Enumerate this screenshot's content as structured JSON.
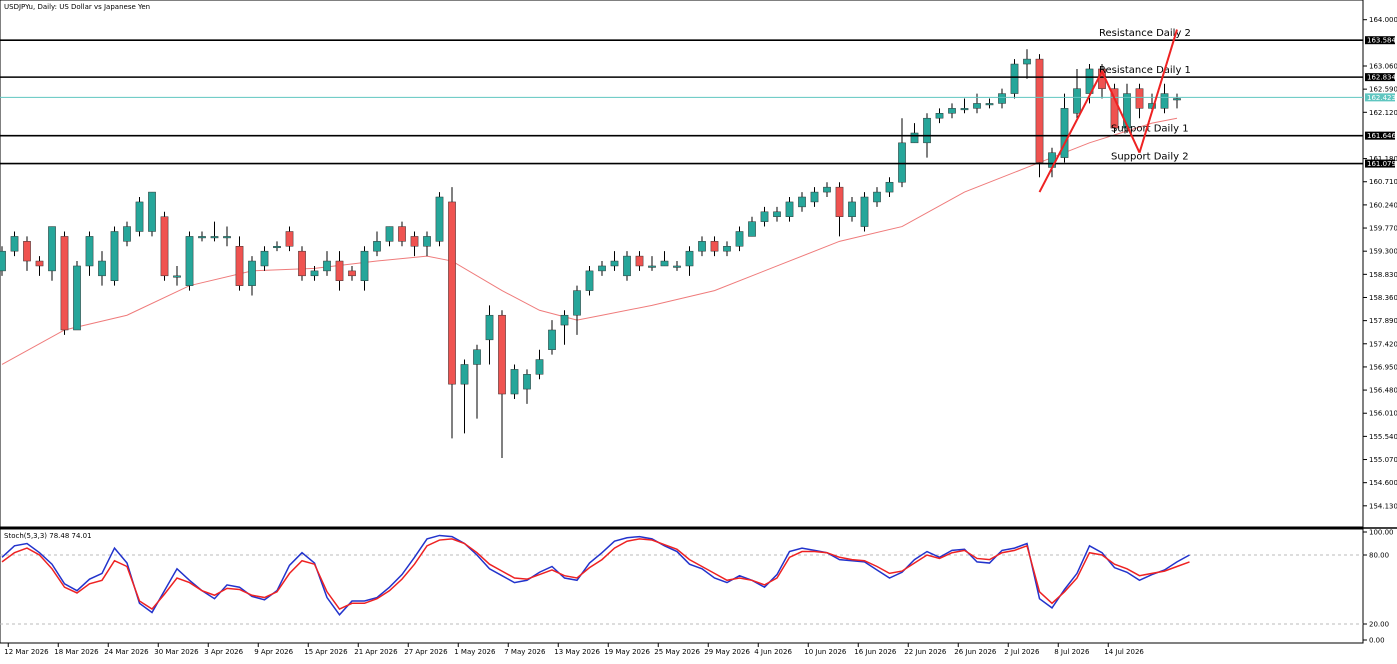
{
  "window": {
    "title": "USDJPYu, Daily:  US Dollar vs Japanese Yen"
  },
  "colors": {
    "bull": "#26a69a",
    "bear": "#ef5350",
    "wick": "#000000",
    "ma": "#ef7b7b",
    "current_price_line": "#5fc6c0",
    "level_line": "#000000",
    "stoch_k": "#2233cc",
    "stoch_d": "#ee2222",
    "trend": "#ee2222"
  },
  "chart_data": [
    {
      "type": "candlestick",
      "title": "USDJPYu, Daily:  US Dollar vs Japanese Yen",
      "ylim": [
        153.7,
        164.4
      ],
      "y_ticks": [
        "164.000",
        "163.060",
        "162.590",
        "162.120",
        "161.180",
        "160.710",
        "160.240",
        "159.770",
        "159.300",
        "158.830",
        "158.360",
        "157.890",
        "157.420",
        "156.950",
        "156.480",
        "156.010",
        "155.540",
        "155.070",
        "154.600",
        "154.130"
      ],
      "x_tick_labels": [
        "12 Mar 2026",
        "18 Mar 2026",
        "24 Mar 2026",
        "30 Mar 2026",
        "3 Apr 2026",
        "9 Apr 2026",
        "15 Apr 2026",
        "21 Apr 2026",
        "27 Apr 2026",
        "1 May 2026",
        "7 May 2026",
        "13 May 2026",
        "19 May 2026",
        "25 May 2026",
        "29 May 2026",
        "4 Jun 2026",
        "10 Jun 2026",
        "16 Jun 2026",
        "22 Jun 2026",
        "26 Jun 2026",
        "2 Jul 2026",
        "8 Jul 2026",
        "14 Jul 2026"
      ],
      "candles": [
        [
          158.9,
          159.3,
          158.8,
          159.4
        ],
        [
          159.3,
          159.6,
          159.2,
          159.7
        ],
        [
          159.5,
          159.1,
          158.9,
          159.6
        ],
        [
          159.1,
          159.0,
          158.8,
          159.2
        ],
        [
          158.9,
          159.8,
          158.7,
          159.8
        ],
        [
          159.6,
          157.7,
          157.6,
          159.7
        ],
        [
          157.7,
          159.0,
          157.7,
          159.1
        ],
        [
          159.0,
          159.6,
          158.8,
          159.7
        ],
        [
          158.8,
          159.1,
          158.6,
          159.3
        ],
        [
          158.7,
          159.7,
          158.6,
          159.8
        ],
        [
          159.5,
          159.8,
          159.4,
          159.9
        ],
        [
          159.7,
          160.3,
          159.6,
          160.4
        ],
        [
          159.7,
          160.5,
          159.6,
          160.5
        ],
        [
          160.0,
          158.8,
          158.7,
          160.1
        ],
        [
          158.8,
          158.8,
          158.6,
          159.0
        ],
        [
          158.6,
          159.6,
          158.5,
          159.7
        ],
        [
          159.6,
          159.6,
          159.5,
          159.7
        ],
        [
          159.6,
          159.6,
          159.5,
          159.9
        ],
        [
          159.6,
          159.6,
          159.4,
          159.8
        ],
        [
          159.4,
          158.6,
          158.5,
          159.6
        ],
        [
          158.6,
          159.1,
          158.4,
          159.2
        ],
        [
          159.0,
          159.3,
          158.9,
          159.4
        ],
        [
          159.4,
          159.4,
          159.3,
          159.5
        ],
        [
          159.7,
          159.4,
          159.3,
          159.8
        ],
        [
          159.3,
          158.8,
          158.7,
          159.4
        ],
        [
          158.8,
          158.9,
          158.7,
          159.0
        ],
        [
          158.9,
          159.1,
          158.8,
          159.3
        ],
        [
          159.1,
          158.7,
          158.5,
          159.3
        ],
        [
          158.9,
          158.8,
          158.7,
          159.0
        ],
        [
          158.7,
          159.3,
          158.5,
          159.4
        ],
        [
          159.3,
          159.5,
          159.2,
          159.7
        ],
        [
          159.5,
          159.8,
          159.4,
          159.8
        ],
        [
          159.8,
          159.5,
          159.4,
          159.9
        ],
        [
          159.6,
          159.4,
          159.2,
          159.7
        ],
        [
          159.4,
          159.6,
          159.2,
          159.7
        ],
        [
          159.5,
          160.4,
          159.4,
          160.5
        ],
        [
          160.3,
          156.6,
          155.5,
          160.6
        ],
        [
          156.6,
          157.0,
          155.6,
          157.1
        ],
        [
          157.0,
          157.3,
          155.9,
          157.4
        ],
        [
          157.5,
          158.0,
          157.0,
          158.2
        ],
        [
          158.0,
          156.4,
          155.1,
          158.1
        ],
        [
          156.4,
          156.9,
          156.3,
          157.0
        ],
        [
          156.5,
          156.8,
          156.2,
          156.9
        ],
        [
          156.8,
          157.1,
          156.7,
          157.3
        ],
        [
          157.3,
          157.7,
          157.2,
          157.9
        ],
        [
          157.8,
          158.0,
          157.4,
          158.1
        ],
        [
          158.0,
          158.5,
          157.6,
          158.6
        ],
        [
          158.5,
          158.9,
          158.4,
          159.0
        ],
        [
          158.9,
          159.0,
          158.8,
          159.1
        ],
        [
          159.0,
          159.1,
          158.9,
          159.3
        ],
        [
          158.8,
          159.2,
          158.7,
          159.3
        ],
        [
          159.2,
          159.0,
          158.9,
          159.3
        ],
        [
          159.0,
          159.0,
          158.9,
          159.2
        ],
        [
          159.0,
          159.1,
          159.0,
          159.3
        ],
        [
          159.0,
          159.0,
          158.9,
          159.1
        ],
        [
          159.0,
          159.3,
          158.8,
          159.4
        ],
        [
          159.3,
          159.5,
          159.2,
          159.6
        ],
        [
          159.5,
          159.3,
          159.2,
          159.6
        ],
        [
          159.3,
          159.4,
          159.2,
          159.5
        ],
        [
          159.4,
          159.7,
          159.3,
          159.8
        ],
        [
          159.6,
          159.9,
          159.6,
          160.0
        ],
        [
          159.9,
          160.1,
          159.8,
          160.2
        ],
        [
          160.0,
          160.1,
          159.9,
          160.2
        ],
        [
          160.0,
          160.3,
          159.9,
          160.4
        ],
        [
          160.2,
          160.4,
          160.1,
          160.5
        ],
        [
          160.3,
          160.5,
          160.2,
          160.6
        ],
        [
          160.5,
          160.6,
          160.4,
          160.7
        ],
        [
          160.6,
          160.0,
          159.6,
          160.7
        ],
        [
          160.0,
          160.3,
          159.9,
          160.4
        ],
        [
          159.8,
          160.4,
          159.7,
          160.5
        ],
        [
          160.3,
          160.5,
          160.2,
          160.6
        ],
        [
          160.5,
          160.7,
          160.4,
          160.8
        ],
        [
          160.7,
          161.5,
          160.6,
          162.0
        ],
        [
          161.5,
          161.7,
          161.5,
          161.9
        ],
        [
          161.5,
          162.0,
          161.2,
          162.1
        ],
        [
          162.0,
          162.1,
          161.9,
          162.2
        ],
        [
          162.1,
          162.2,
          162.0,
          162.3
        ],
        [
          162.2,
          162.2,
          162.1,
          162.4
        ],
        [
          162.2,
          162.3,
          162.1,
          162.5
        ],
        [
          162.3,
          162.3,
          162.2,
          162.4
        ],
        [
          162.3,
          162.5,
          162.2,
          162.6
        ],
        [
          162.5,
          163.1,
          162.4,
          163.2
        ],
        [
          163.1,
          163.2,
          162.8,
          163.4
        ],
        [
          163.2,
          161.1,
          160.8,
          163.3
        ],
        [
          161.0,
          161.3,
          160.8,
          161.4
        ],
        [
          161.2,
          162.2,
          161.1,
          162.5
        ],
        [
          162.1,
          162.6,
          162.0,
          163.0
        ],
        [
          162.5,
          163.0,
          162.3,
          163.1
        ],
        [
          163.0,
          162.6,
          162.4,
          163.1
        ],
        [
          162.6,
          161.8,
          161.7,
          162.7
        ],
        [
          161.8,
          162.5,
          161.7,
          162.7
        ],
        [
          162.6,
          162.2,
          162.0,
          162.7
        ],
        [
          162.2,
          162.3,
          162.1,
          162.5
        ],
        [
          162.2,
          162.5,
          162.1,
          162.7
        ],
        [
          162.4,
          162.4,
          162.2,
          162.5
        ]
      ],
      "ma": [
        {
          "i": 0,
          "v": 157.0
        },
        {
          "i": 5,
          "v": 157.7
        },
        {
          "i": 10,
          "v": 158.0
        },
        {
          "i": 15,
          "v": 158.6
        },
        {
          "i": 20,
          "v": 158.9
        },
        {
          "i": 25,
          "v": 158.95
        },
        {
          "i": 30,
          "v": 159.1
        },
        {
          "i": 34,
          "v": 159.2
        },
        {
          "i": 36,
          "v": 159.1
        },
        {
          "i": 40,
          "v": 158.5
        },
        {
          "i": 43,
          "v": 158.1
        },
        {
          "i": 46,
          "v": 157.9
        },
        {
          "i": 48,
          "v": 158.0
        },
        {
          "i": 52,
          "v": 158.2
        },
        {
          "i": 57,
          "v": 158.5
        },
        {
          "i": 62,
          "v": 159.0
        },
        {
          "i": 67,
          "v": 159.5
        },
        {
          "i": 72,
          "v": 159.8
        },
        {
          "i": 77,
          "v": 160.5
        },
        {
          "i": 82,
          "v": 161.0
        },
        {
          "i": 87,
          "v": 161.5
        },
        {
          "i": 92,
          "v": 161.9
        },
        {
          "i": 94,
          "v": 162.0
        }
      ],
      "levels": [
        {
          "label": "Resistance Daily 2",
          "price": 163.584,
          "price_text": "163.584"
        },
        {
          "label": "Resistance Daily 1",
          "price": 162.834,
          "price_text": "162.834"
        },
        {
          "label": "Support Daily 1",
          "price": 161.646,
          "price_text": "161.646"
        },
        {
          "label": "Support Daily 2",
          "price": 161.079,
          "price_text": "161.079"
        }
      ],
      "current_price": {
        "price": 162.423,
        "price_text": "162.423"
      },
      "trend_lines": [
        [
          {
            "i": 83,
            "p": 160.5
          },
          {
            "i": 88,
            "p": 162.95
          }
        ],
        [
          {
            "i": 88,
            "p": 162.95
          },
          {
            "i": 91,
            "p": 161.3
          }
        ],
        [
          {
            "i": 91,
            "p": 161.3
          },
          {
            "i": 94,
            "p": 163.8
          }
        ]
      ]
    },
    {
      "type": "line",
      "title": "Stoch(5,3,3) 78.48 74.01",
      "ylim": [
        0,
        100
      ],
      "y_ticks": [
        "100.00",
        "80.00",
        "20.00",
        "0.00"
      ],
      "series": [
        {
          "name": "",
          "values": [
            78,
            88,
            90,
            82,
            72,
            55,
            49,
            59,
            64,
            86,
            73,
            38,
            30,
            49,
            68,
            58,
            49,
            42,
            54,
            52,
            44,
            41,
            49,
            71,
            82,
            73,
            43,
            28,
            40,
            40,
            43,
            52,
            63,
            78,
            94,
            97,
            96,
            90,
            80,
            68,
            62,
            56,
            58,
            65,
            70,
            60,
            58,
            73,
            82,
            92,
            95,
            96,
            94,
            88,
            83,
            72,
            68,
            60,
            56,
            62,
            58,
            52,
            63,
            83,
            86,
            84,
            82,
            76,
            75,
            74,
            67,
            60,
            65,
            76,
            83,
            78,
            84,
            85,
            74,
            73,
            84,
            86,
            90,
            42,
            34,
            50,
            64,
            88,
            82,
            69,
            65,
            58,
            63,
            67,
            74,
            80
          ]
        },
        {
          "name": "",
          "values": [
            74,
            82,
            86,
            80,
            68,
            52,
            47,
            55,
            58,
            75,
            70,
            40,
            33,
            46,
            60,
            56,
            49,
            45,
            51,
            50,
            45,
            43,
            48,
            64,
            75,
            72,
            48,
            33,
            38,
            38,
            42,
            49,
            59,
            72,
            88,
            93,
            94,
            90,
            82,
            72,
            66,
            60,
            59,
            63,
            67,
            62,
            60,
            69,
            76,
            86,
            92,
            94,
            93,
            89,
            85,
            76,
            70,
            64,
            58,
            60,
            58,
            54,
            60,
            78,
            83,
            83,
            82,
            78,
            76,
            75,
            70,
            64,
            66,
            73,
            80,
            77,
            82,
            84,
            77,
            76,
            82,
            84,
            88,
            48,
            38,
            48,
            60,
            82,
            80,
            72,
            68,
            62,
            64,
            66,
            70,
            74
          ]
        }
      ]
    }
  ]
}
